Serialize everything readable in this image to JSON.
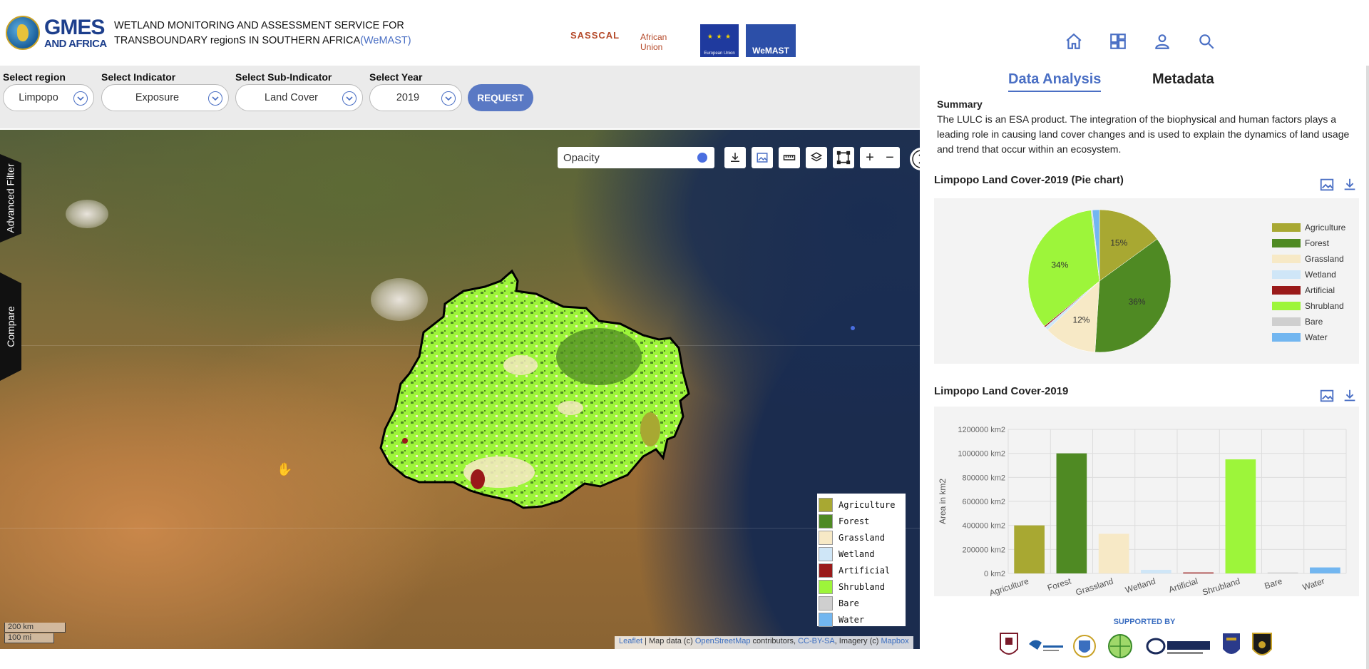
{
  "header": {
    "logo_line1": "GMES",
    "logo_line2": "AND AFRICA",
    "title_line1": "WETLAND MONITORING AND ASSESSMENT SERVICE FOR",
    "title_line2": "TRANSBOUNDARY regionS IN SOUTHERN AFRICA",
    "title_acronym": "(WeMAST)",
    "partners": {
      "sasscal": "SASSCAL",
      "african_union_1": "African",
      "african_union_2": "Union",
      "eu": "European Union",
      "wemast": "WeMAST"
    },
    "nav_icons": [
      "home-icon",
      "dashboard-icon",
      "user-icon",
      "search-icon"
    ]
  },
  "selectors": {
    "region": {
      "label": "Select region",
      "value": "Limpopo"
    },
    "indicator": {
      "label": "Select Indicator",
      "value": "Exposure"
    },
    "sub_indicator": {
      "label": "Select Sub-Indicator",
      "value": "Land Cover"
    },
    "year": {
      "label": "Select Year",
      "value": "2019"
    },
    "request_label": "REQUEST"
  },
  "map": {
    "side_tabs": {
      "advanced_filter": "Advanced Filter",
      "compare": "Compare"
    },
    "opacity_label": "Opacity",
    "zoom_in": "+",
    "zoom_out": "−",
    "scale_km": "200 km",
    "scale_mi": "100 mi",
    "attribution": {
      "leaflet": "Leaflet",
      "text1": " | Map data (c) ",
      "osm": "OpenStreetMap",
      "text2": " contributors, ",
      "ccbysa": "CC-BY-SA",
      "text3": ", Imagery (c) ",
      "mapbox": "Mapbox"
    },
    "legend": [
      {
        "label": "Agriculture",
        "color": "#a8a832"
      },
      {
        "label": "Forest",
        "color": "#4f8a23"
      },
      {
        "label": "Grassland",
        "color": "#f7e9c6"
      },
      {
        "label": "Wetland",
        "color": "#cfe6f7"
      },
      {
        "label": "Artificial",
        "color": "#9a1a1a"
      },
      {
        "label": "Shrubland",
        "color": "#9df53a"
      },
      {
        "label": "Bare",
        "color": "#cfcfcf"
      },
      {
        "label": "Water",
        "color": "#72b6f0"
      }
    ]
  },
  "panel": {
    "tabs": {
      "data_analysis": "Data Analysis",
      "metadata": "Metadata"
    },
    "summary_heading": "Summary",
    "summary_text": "The LULC is an ESA product. The integration of the biophysical and human factors plays a leading role in causing land cover changes and is used to explain the dynamics of land usage and trend that occur within an ecosystem.",
    "pie_title": "Limpopo Land Cover-2019 (Pie chart)",
    "bar_title": "Limpopo Land Cover-2019",
    "supported_by": "SUPPORTED BY",
    "sponsors": [
      "University of Botswana",
      "Cape Peninsula University of Technology",
      "University crest",
      "Regional centre",
      "sansa SPACE AGENCY",
      "University of the Western Cape",
      "University shield"
    ]
  },
  "chart_data": [
    {
      "type": "pie",
      "title": "Limpopo Land Cover-2019 (Pie chart)",
      "categories": [
        "Agriculture",
        "Forest",
        "Grassland",
        "Wetland",
        "Artificial",
        "Shrubland",
        "Bare",
        "Water"
      ],
      "values": [
        15,
        36,
        12,
        0.8,
        0.3,
        34,
        0.3,
        1.6
      ],
      "data_labels": [
        "15%",
        "36%",
        "12%",
        "",
        "",
        "34%",
        "",
        ""
      ],
      "colors": [
        "#a8a832",
        "#4f8a23",
        "#f7e9c6",
        "#cfe6f7",
        "#9a1a1a",
        "#9df53a",
        "#cfcfcf",
        "#72b6f0"
      ],
      "legend_position": "right"
    },
    {
      "type": "bar",
      "title": "Limpopo Land Cover-2019",
      "categories": [
        "Agriculture",
        "Forest",
        "Grassland",
        "Wetland",
        "Artificial",
        "Shrubland",
        "Bare",
        "Water"
      ],
      "values": [
        400000,
        1000000,
        330000,
        30000,
        8000,
        950000,
        8000,
        50000
      ],
      "colors": [
        "#a8a832",
        "#4f8a23",
        "#f7e9c6",
        "#cfe6f7",
        "#9a1a1a",
        "#9df53a",
        "#cfcfcf",
        "#72b6f0"
      ],
      "ylabel": "Area in  km2",
      "ylim": [
        0,
        1200000
      ],
      "yticks": [
        "0 km2",
        "200000 km2",
        "400000 km2",
        "600000 km2",
        "800000 km2",
        "1000000 km2",
        "1200000 km2"
      ],
      "grid": true
    }
  ]
}
